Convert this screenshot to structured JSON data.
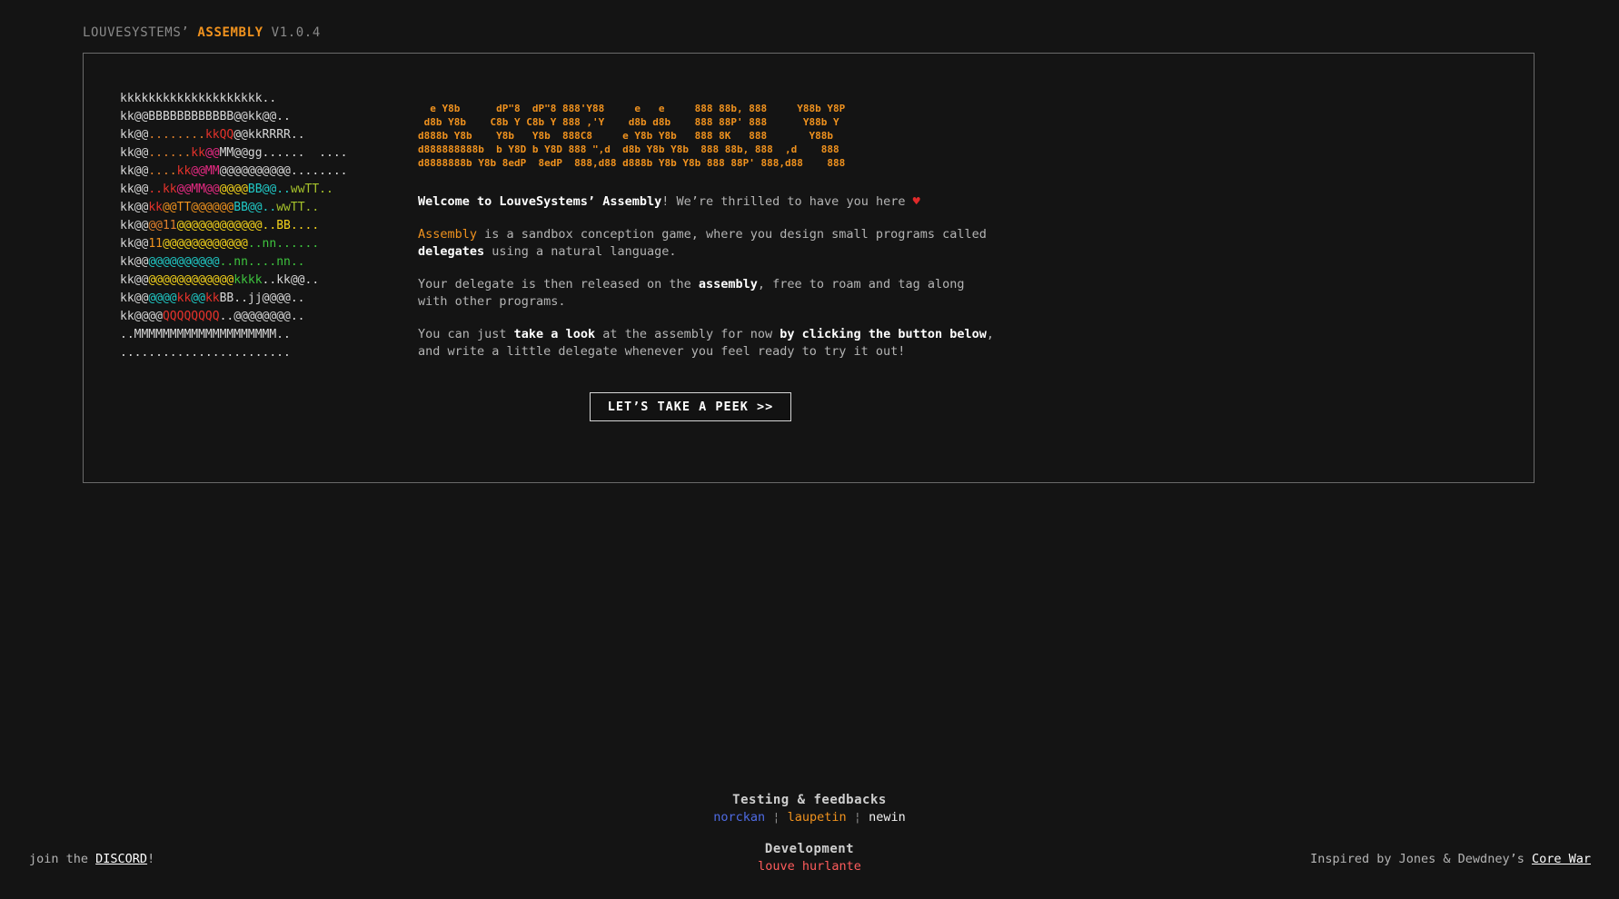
{
  "header": {
    "company": "LOUVESYSTEMS’",
    "product": "ASSEMBLY",
    "version": "V1.0.4"
  },
  "ascii_art": [
    [
      [
        "kkkkkkkkkkkkkkkkkkkk..",
        "#d8d8d8"
      ]
    ],
    [
      [
        "kk@@BBBBBBBBBBBB@@kk@@..",
        "#d8d8d8"
      ]
    ],
    [
      [
        "kk@@",
        "#d8d8d8"
      ],
      [
        "........",
        "#e0802b"
      ],
      [
        "kkQQ",
        "#e5322b"
      ],
      [
        "@@kkRRRR..",
        "#d8d8d8"
      ]
    ],
    [
      [
        "kk@@",
        "#d8d8d8"
      ],
      [
        "......",
        "#e0802b"
      ],
      [
        "kk",
        "#e5322b"
      ],
      [
        "@@",
        "#e72a83"
      ],
      [
        "MM@@gg......  ....",
        "#d8d8d8"
      ]
    ],
    [
      [
        "kk@@",
        "#d8d8d8"
      ],
      [
        "....",
        "#e0802b"
      ],
      [
        "kk",
        "#e5322b"
      ],
      [
        "@@MM",
        "#e72a83"
      ],
      [
        "@@",
        "#d8d8d8"
      ],
      [
        "@@@@@@@@........",
        "#d8d8d8"
      ]
    ],
    [
      [
        "kk@@",
        "#d8d8d8"
      ],
      [
        "..kk",
        "#e5322b"
      ],
      [
        "@@MM@@",
        "#e72a83"
      ],
      [
        "@@@@",
        "#f3d21b"
      ],
      [
        "BB@@..",
        "#20c9c6"
      ],
      [
        "wwTT..",
        "#a6c22b"
      ]
    ],
    [
      [
        "kk@@",
        "#d8d8d8"
      ],
      [
        "kk",
        "#e5322b"
      ],
      [
        "@@TT@@@@@@",
        "#f0921e"
      ],
      [
        "BB@@..",
        "#20c9c6"
      ],
      [
        "wwTT..",
        "#a6c22b"
      ]
    ],
    [
      [
        "kk@@",
        "#d8d8d8"
      ],
      [
        "@@11",
        "#e0802b"
      ],
      [
        "@@@@@@@@@@@@..BB....",
        "#f3d21b"
      ]
    ],
    [
      [
        "kk@@",
        "#d8d8d8"
      ],
      [
        "11",
        "#f0921e"
      ],
      [
        "@@@@@@@@@@@@",
        "#f3d21b"
      ],
      [
        "..nn......",
        "#3ec43e"
      ]
    ],
    [
      [
        "kk@@",
        "#d8d8d8"
      ],
      [
        "@@@@@@@@@@",
        "#20c9c6"
      ],
      [
        "..nn....nn..",
        "#3ec43e"
      ]
    ],
    [
      [
        "kk@@",
        "#d8d8d8"
      ],
      [
        "@@@@@@@@@@@@",
        "#f3d21b"
      ],
      [
        "kkkk",
        "#3ec43e"
      ],
      [
        "..kk@@..",
        "#d8d8d8"
      ]
    ],
    [
      [
        "kk@@",
        "#d8d8d8"
      ],
      [
        "@@@@",
        "#20c9c6"
      ],
      [
        "kk",
        "#e5322b"
      ],
      [
        "@@",
        "#20c9c6"
      ],
      [
        "kk",
        "#e5322b"
      ],
      [
        "BB..jj@@@@..",
        "#d8d8d8"
      ]
    ],
    [
      [
        "kk@@@@",
        "#d8d8d8"
      ],
      [
        "QQQQQQQQ",
        "#e5322b"
      ],
      [
        "..@@@@@@@@..",
        "#d8d8d8"
      ]
    ],
    [
      [
        "..MMMMMMMMMMMMMMMMMMMM..",
        "#d8d8d8"
      ]
    ],
    [
      [
        "........................",
        "#d8d8d8"
      ]
    ]
  ],
  "logo_lines": [
    "  e Y8b      dP\"8  dP\"8 888'Y88     e   e     888 88b, 888     Y88b Y8P",
    " d8b Y8b    C8b Y C8b Y 888 ,'Y    d8b d8b    888 88P' 888      Y88b Y",
    "d888b Y8b    Y8b   Y8b  888C8     e Y8b Y8b   888 8K   888       Y88b",
    "d888888888b  b Y8D b Y8D 888 \",d  d8b Y8b Y8b  888 88b, 888  ,d    888",
    "d8888888b Y8b 8edP  8edP  888,d88 d888b Y8b Y8b 888 88P' 888,d88    888"
  ],
  "intro": {
    "p1_a": "Welcome to LouveSystems’",
    "p1_b": "Assembly",
    "p1_c": "! We’re thrilled to have you here",
    "p1_heart": "♥",
    "p2_a": "Assembly",
    "p2_b": " is a sandbox conception game, where you design small programs called ",
    "p2_c": "delegates",
    "p2_d": " using a natural language.",
    "p3_a": "Your delegate is then released on the ",
    "p3_b": "assembly",
    "p3_c": ", free to roam and tag along with other programs.",
    "p4_a": "You can just ",
    "p4_b": "take a look",
    "p4_c": " at the assembly for now ",
    "p4_d": "by clicking the button below",
    "p4_e": ", and write a little delegate whenever you feel ready to try it out!"
  },
  "cta_label": "LET’S TAKE A PEEK >>",
  "credits": {
    "testing_title": "Testing & feedbacks",
    "tester1": "norckan",
    "sep": "¦",
    "tester2": "laupetin",
    "tester3": "newin",
    "dev_title": "Development",
    "developer": "louve hurlante"
  },
  "footer": {
    "left_pre": "join the ",
    "left_link": "DISCORD",
    "left_post": "!",
    "right_pre": "Inspired by Jones & Dewdney’s ",
    "right_link": "Core War"
  },
  "colors": {
    "background": "#141414",
    "accent": "#f0921e",
    "link_blue": "#4f6be4",
    "red": "#ff5c5c",
    "heart": "#e02a2a"
  }
}
